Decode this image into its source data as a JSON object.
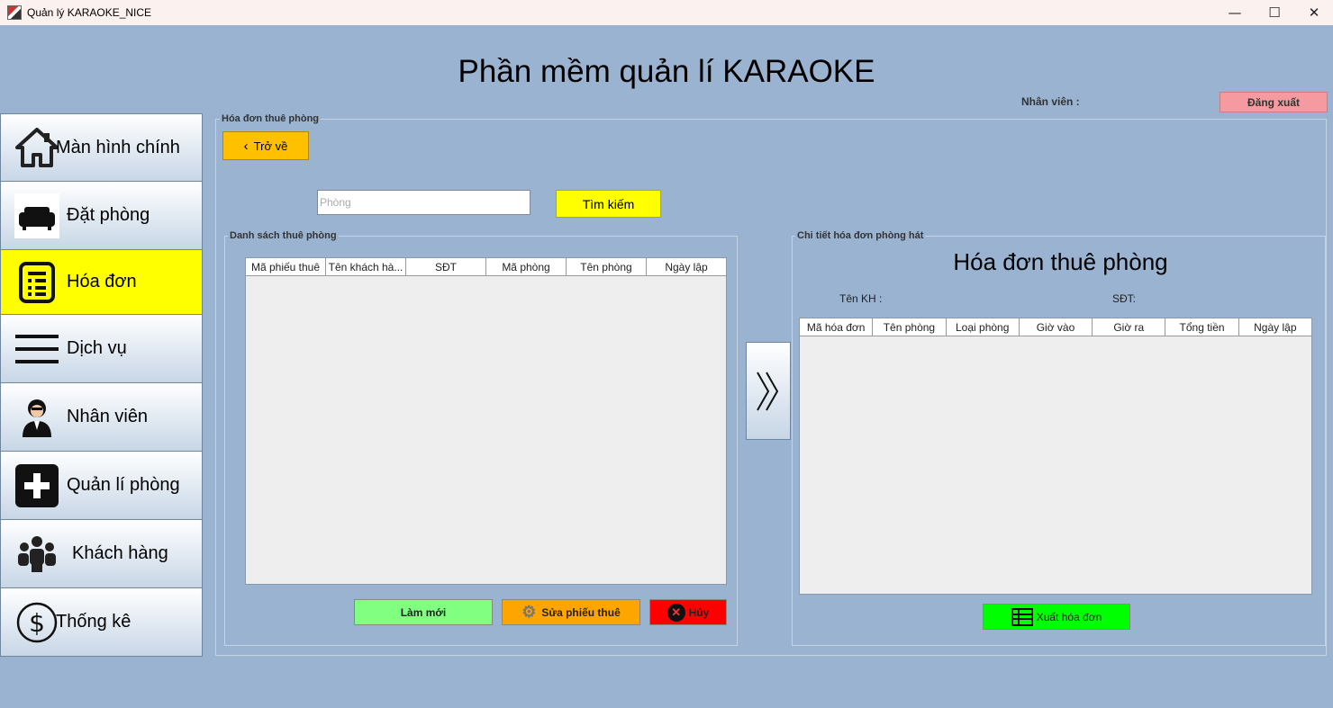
{
  "window": {
    "title": "Quản lý KARAOKE_NICE",
    "minimize_icon": "—",
    "maximize_icon": "☐",
    "close_icon": "✕"
  },
  "header": {
    "title": "Phần mềm quản lí KARAOKE",
    "staff_label": "Nhân viên :",
    "logout_label": "Đăng xuất"
  },
  "sidebar": {
    "items": [
      {
        "label": "Màn hình chính",
        "icon": "home-icon"
      },
      {
        "label": "Đặt phòng",
        "icon": "sofa-icon"
      },
      {
        "label": "Hóa đơn",
        "icon": "invoice-icon",
        "active": true
      },
      {
        "label": "Dịch vụ",
        "icon": "menu-icon"
      },
      {
        "label": "Nhân viên",
        "icon": "employee-icon"
      },
      {
        "label": "Quản lí phòng",
        "icon": "plus-icon"
      },
      {
        "label": "Khách hàng",
        "icon": "people-icon"
      },
      {
        "label": "Thống kê",
        "icon": "dollar-icon"
      }
    ]
  },
  "content": {
    "group_title": "Hóa đơn thuê phòng",
    "back_label": "Trở về",
    "search": {
      "placeholder": "Phòng",
      "button_label": "Tìm kiếm"
    },
    "rental_list": {
      "title": "Danh sách thuê phòng",
      "columns": [
        "Mã phiếu thuê",
        "Tên khách hà...",
        "SĐT",
        "Mã phòng",
        "Tên phòng",
        "Ngày lập"
      ],
      "refresh_label": "Làm mới",
      "edit_label": "Sửa phiếu thuê",
      "cancel_label": "Hủy"
    },
    "invoice_detail": {
      "title": "Chi tiết hóa đơn phòng hát",
      "heading": "Hóa đơn thuê phòng",
      "customer_label": "Tên KH :",
      "phone_label": "SĐT:",
      "columns": [
        "Mã hóa đơn",
        "Tên phòng",
        "Loại phòng",
        "Giờ vào",
        "Giờ ra",
        "Tổng tiền",
        "Ngày lập"
      ],
      "export_label": "Xuất hóa đơn"
    }
  },
  "colors": {
    "background": "#9ab3d1",
    "active_nav": "#ffff00",
    "back_button": "#ffc000",
    "logout": "#f49aa0",
    "refresh": "#80ff80",
    "edit": "#ffa500",
    "cancel": "#ff0000",
    "export": "#00ff00"
  }
}
